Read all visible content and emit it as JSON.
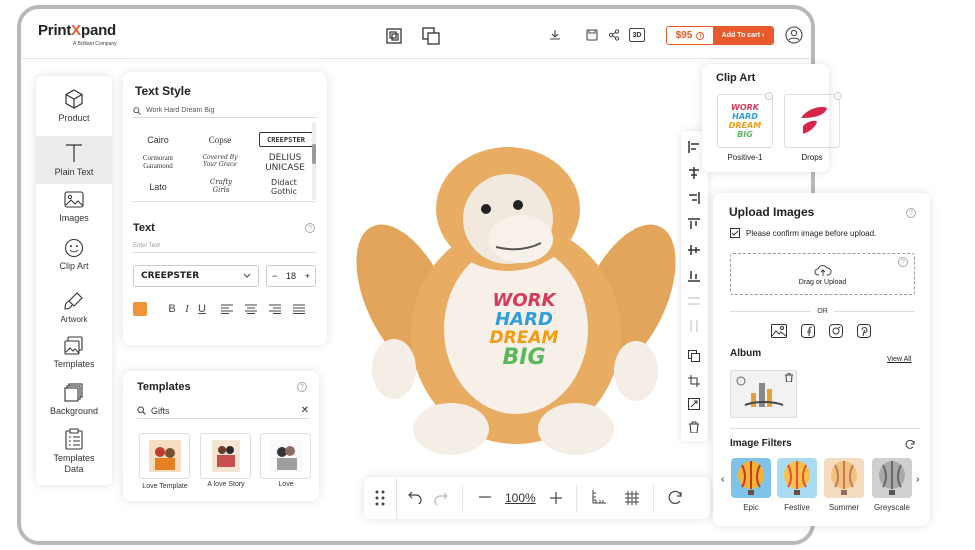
{
  "brand": {
    "name_pre": "Print",
    "name_x": "X",
    "name_post": "pand",
    "tagline": "A Brilliant Company"
  },
  "topbar": {
    "price": "$95",
    "price_info": "i",
    "cart_label": "Add To cart",
    "cart_arrow": "›",
    "three_d": "3D"
  },
  "sidebar": {
    "items": [
      {
        "label": "Product"
      },
      {
        "label": "Plain Text"
      },
      {
        "label": "Images"
      },
      {
        "label": "Clip Art"
      },
      {
        "label": "Artwork"
      },
      {
        "label": "Templates"
      },
      {
        "label": "Background"
      },
      {
        "label": "Templates Data"
      }
    ]
  },
  "text_style": {
    "title": "Text Style",
    "search_value": "Work Hard Dream Big",
    "fonts": [
      "Cairo",
      "Copse",
      "CREEPSTER",
      "Cormorant Garamond",
      "Covered By Your Grace",
      "DELIUS UNICASE",
      "Lato",
      "Crafty Girls",
      "Didact Gothic"
    ],
    "text_title": "Text",
    "text_placeholder": "Enter Text",
    "selected_font": "CREEPSTER",
    "font_size": "18",
    "minus": "−",
    "plus": "+",
    "accent_color": "#f0953b",
    "bold": "B",
    "italic": "I",
    "underline": "U"
  },
  "templates": {
    "title": "Templates",
    "search_value": "Gifts",
    "items": [
      {
        "label": "Love Template"
      },
      {
        "label": "A love Story"
      },
      {
        "label": "Love"
      }
    ]
  },
  "artwork": {
    "line1": "WORK",
    "line2": "HARD",
    "line3": "DREAM",
    "line4": "BIG"
  },
  "zoom": {
    "level": "100%"
  },
  "clip_art": {
    "title": "Clip Art",
    "items": [
      {
        "label": "Positive-1"
      },
      {
        "label": "Drops"
      }
    ]
  },
  "upload": {
    "title": "Upload Images",
    "confirm_label": "Please confirm image before upload.",
    "drag_label": "Drag or Upload",
    "or_label": "OR",
    "album_title": "Album",
    "view_all": "View All",
    "filters_title": "Image Filters",
    "filters": [
      {
        "label": "Epic"
      },
      {
        "label": "Festive"
      },
      {
        "label": "Summer"
      },
      {
        "label": "Greyscale"
      }
    ]
  },
  "colors": {
    "brand": "#e8592b",
    "accent": "#f0953b"
  }
}
